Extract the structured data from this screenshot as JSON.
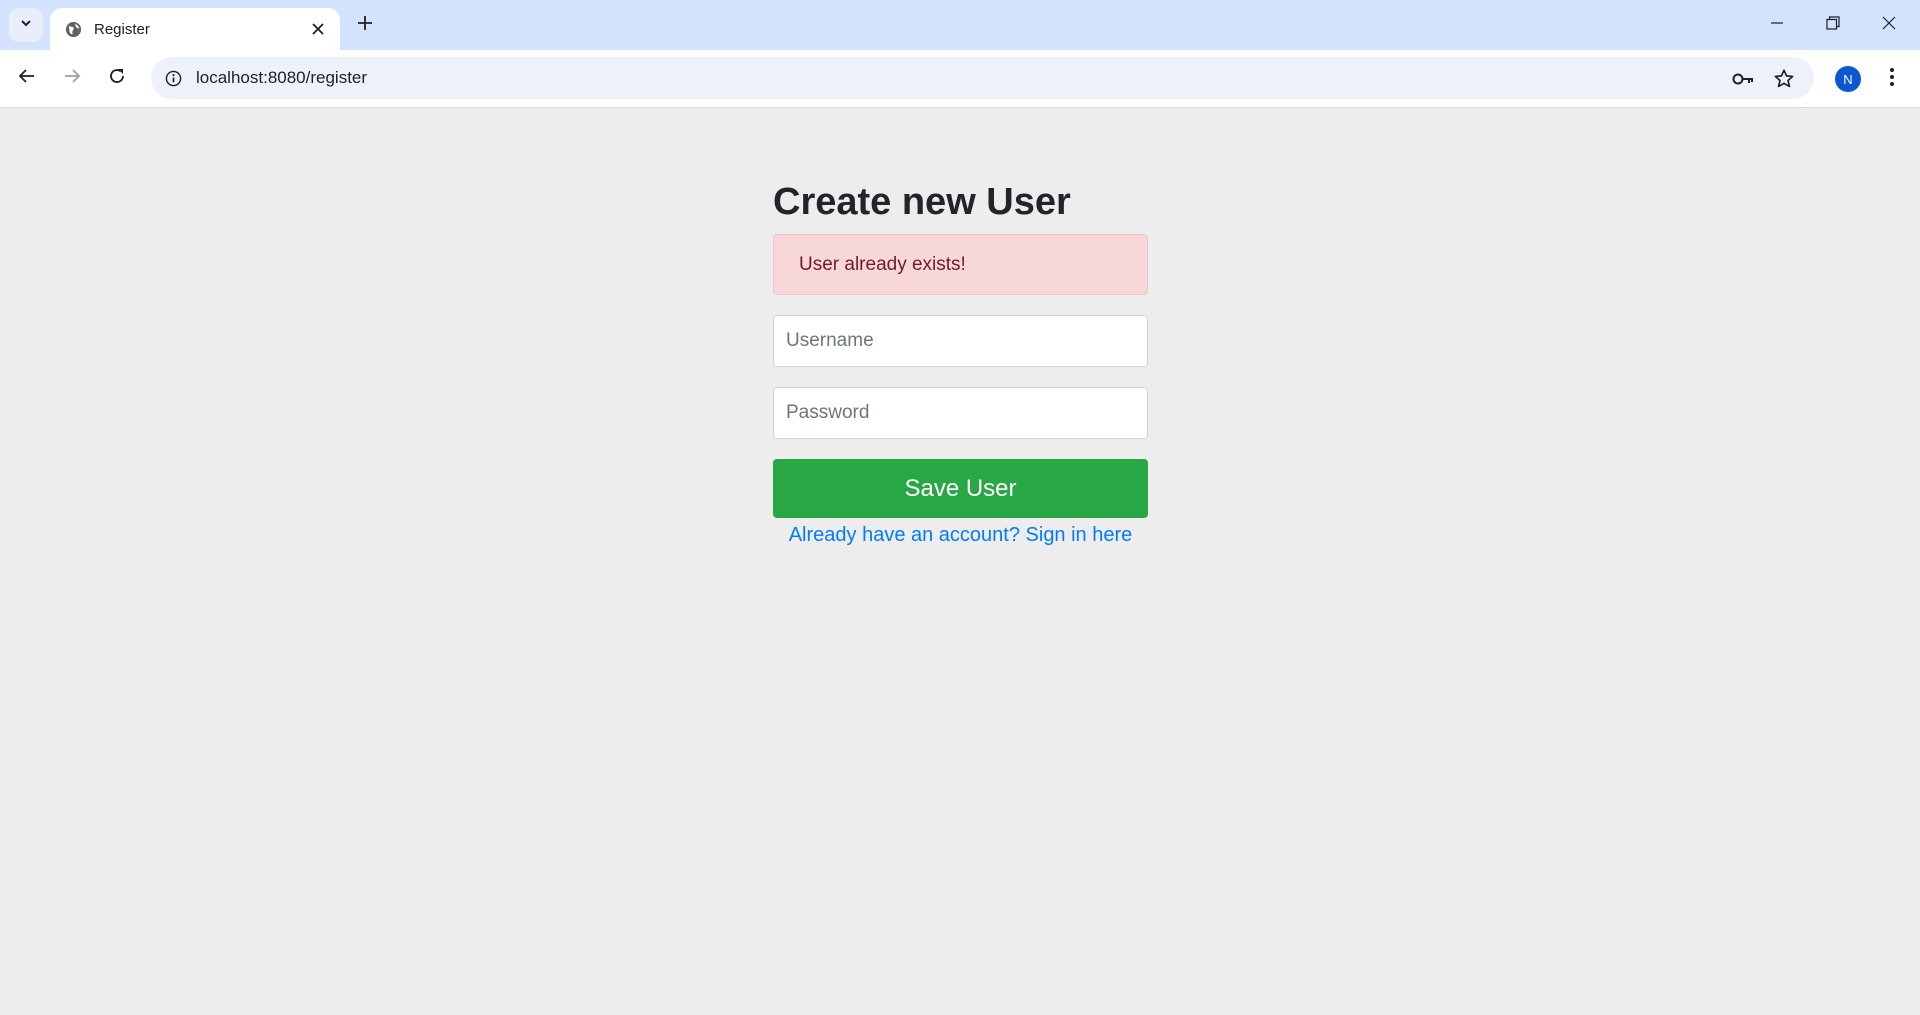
{
  "browser": {
    "tab_title": "Register",
    "url": "localhost:8080/register",
    "profile_initial": "N"
  },
  "form": {
    "heading": "Create new User",
    "alert": "User already exists!",
    "username_placeholder": "Username",
    "password_placeholder": "Password",
    "save_label": "Save User",
    "signin_link": "Already have an account? Sign in here"
  },
  "colors": {
    "alert_bg": "#f8d7da",
    "save_button": "#28a745",
    "link": "#007bff"
  }
}
